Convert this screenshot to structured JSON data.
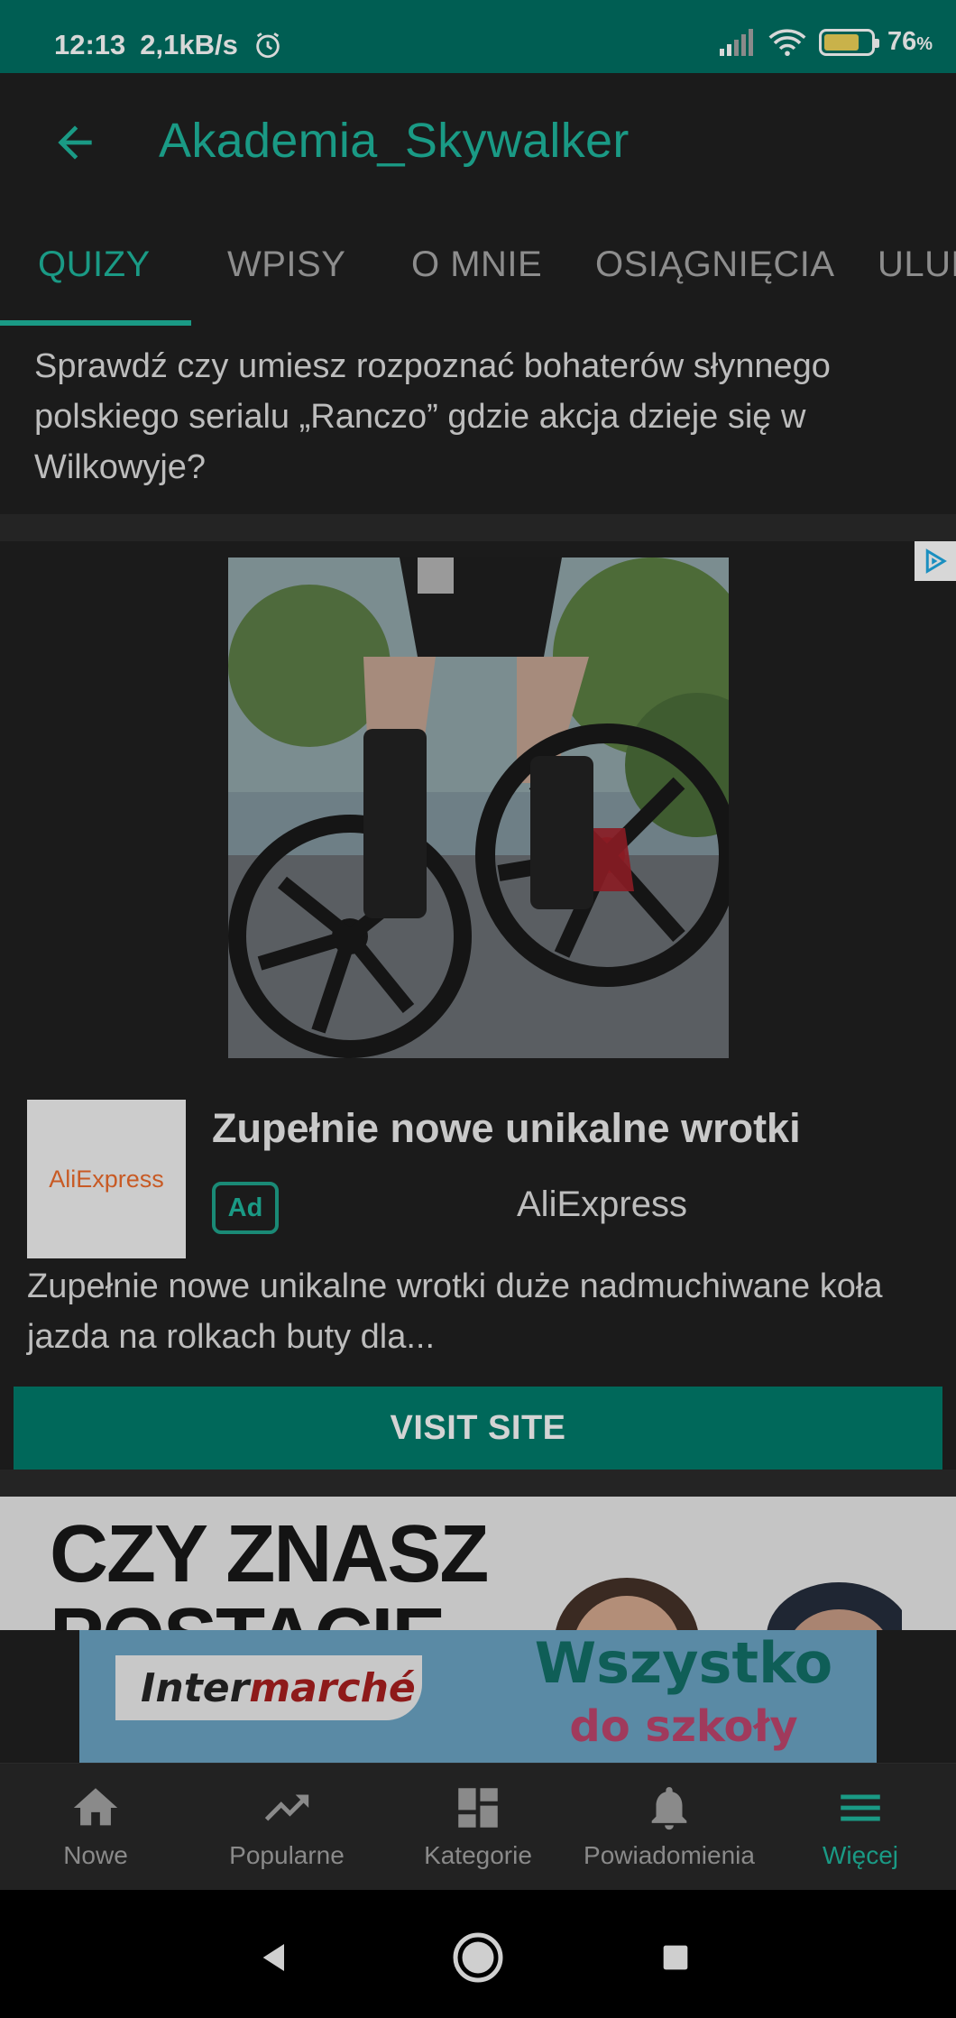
{
  "status_bar": {
    "time": "12:13",
    "speed": "2,1kB/s",
    "battery": "76",
    "battery_unit": "%",
    "battery_level": 0.76
  },
  "app_bar": {
    "title": "Akademia_Skywalker"
  },
  "tabs": [
    {
      "label": "QUIZY",
      "active": true
    },
    {
      "label": "WPISY",
      "active": false
    },
    {
      "label": "O MNIE",
      "active": false
    },
    {
      "label": "OSIĄGNIĘCIA",
      "active": false
    },
    {
      "label": "ULUB",
      "active": false
    }
  ],
  "intro_text": "Sprawdź czy umiesz rozpoznać bohaterów słynnego polskiego serialu „Ranczo” gdzie akcja dzieje się w Wilkowyje?",
  "ad": {
    "logo_text": "AliExpress",
    "headline": "Zupełnie nowe unikalne wrotki",
    "badge": "Ad",
    "advertiser": "AliExpress",
    "body": "Zupełnie nowe unikalne wrotki duże nadmuchiwane koła jazda na rolkach buty dla...",
    "cta": "VISIT SITE"
  },
  "quiz_preview": {
    "line1": "CZY ZNASZ",
    "line2": "POSTACIE"
  },
  "banner": {
    "brand_prefix": "Inter",
    "brand_suffix": "marché",
    "slogan_line1": "Wszystko",
    "slogan_line2": "do szkoły"
  },
  "bottom_nav": [
    {
      "label": "Nowe",
      "icon": "home-icon",
      "active": false
    },
    {
      "label": "Popularne",
      "icon": "trending-icon",
      "active": false
    },
    {
      "label": "Kategorie",
      "icon": "dashboard-icon",
      "active": false
    },
    {
      "label": "Powiadomienia",
      "icon": "bell-icon",
      "active": false
    },
    {
      "label": "Więcej",
      "icon": "menu-icon",
      "active": true
    }
  ],
  "colors": {
    "accent": "#1a9a85",
    "status_bar": "#005e53",
    "cta": "#00685a",
    "background": "#1b1b1b"
  }
}
